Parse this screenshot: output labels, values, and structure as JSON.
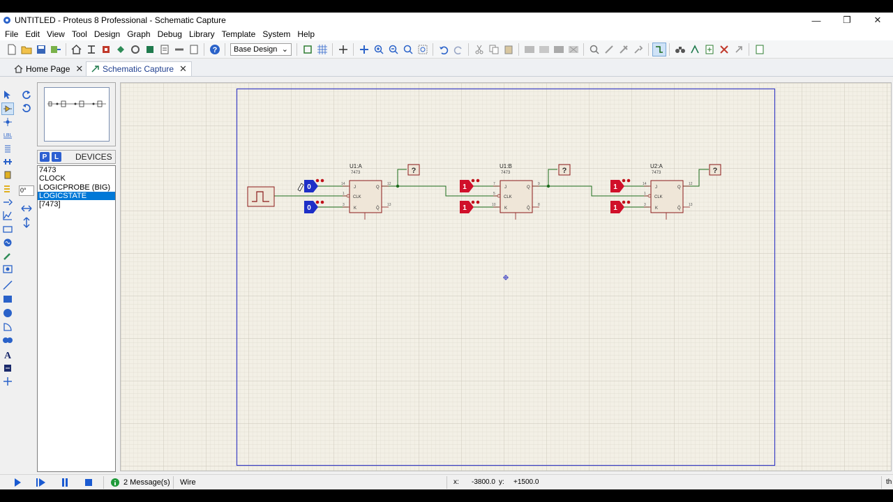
{
  "window": {
    "title": "UNTITLED - Proteus 8 Professional - Schematic Capture",
    "minimize": "—",
    "maximize": "❐",
    "close": "✕"
  },
  "menu": [
    "File",
    "Edit",
    "View",
    "Tool",
    "Design",
    "Graph",
    "Debug",
    "Library",
    "Template",
    "System",
    "Help"
  ],
  "toolbar": {
    "design_select": "Base Design"
  },
  "tabs": [
    {
      "label": "Home Page",
      "icon": "home-icon"
    },
    {
      "label": "Schematic Capture",
      "icon": "schematic-icon"
    }
  ],
  "left_tools": {
    "rotation_value": "0°"
  },
  "devices": {
    "p_label": "P",
    "l_label": "L",
    "title": "DEVICES",
    "items": [
      "7473",
      "CLOCK",
      "LOGICPROBE (BIG)",
      "LOGICSTATE",
      "[7473]"
    ],
    "selected_index": 3
  },
  "schematic": {
    "components": [
      {
        "ref": "U1:A",
        "part": "7473",
        "pin_j": "14",
        "pin_clk": "1",
        "pin_k": "3",
        "pin_q": "12",
        "pin_qbar": "13"
      },
      {
        "ref": "U1:B",
        "part": "7473",
        "pin_j": "7",
        "pin_clk": "5",
        "pin_k": "10",
        "pin_q": "9",
        "pin_qbar": "8"
      },
      {
        "ref": "U2:A",
        "part": "7473",
        "pin_j": "14",
        "pin_clk": "1",
        "pin_k": "3",
        "pin_q": "12",
        "pin_qbar": "13"
      }
    ],
    "pin_labels": {
      "j": "J",
      "clk": "CLK",
      "k": "K",
      "q": "Q",
      "qbar": "Q̄"
    },
    "logic_states": [
      "0",
      "0",
      "1",
      "1",
      "1",
      "1"
    ],
    "probe_text": "?",
    "colors": {
      "sheet_bg": "#f3f0e6",
      "grid": "#d7d4ca",
      "sheet_border": "#3b3fc4",
      "chip_fill": "#efe6d8",
      "chip_border": "#8b1a1a",
      "wire": "#1b6b1b",
      "state_low": "#1d2fc7",
      "state_high": "#d0102a"
    }
  },
  "status": {
    "messages": "2 Message(s)",
    "mode": "Wire",
    "x_label": "x:",
    "x_value": "-3800.0",
    "y_label": "y:",
    "y_value": "+1500.0",
    "units": "th"
  }
}
